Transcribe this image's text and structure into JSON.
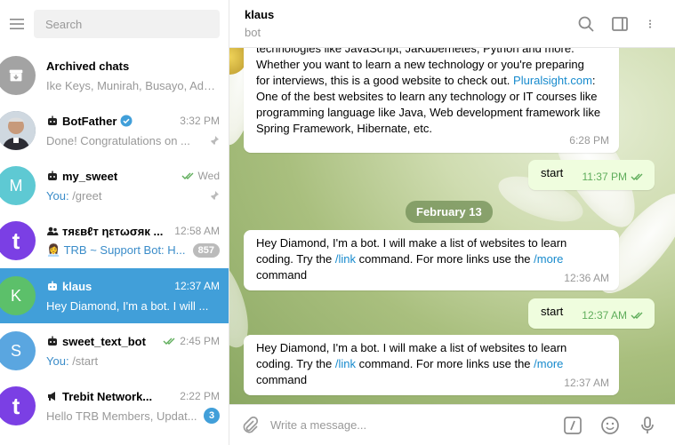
{
  "sidebar": {
    "search_placeholder": "Search",
    "chats": [
      {
        "title": "Archived chats",
        "preview": "Ike Keys, Munirah, Busayo, Ada...",
        "time": "",
        "avatar_letter": "",
        "avatar_color": "#a3a3a3"
      },
      {
        "title": "BotFather",
        "preview": "Done! Congratulations on ...",
        "time": "3:32 PM",
        "avatar_letter": "",
        "avatar_color": "#6d7d8f"
      },
      {
        "title": "my_sweet",
        "preview_you": "You:",
        "preview": "/greet",
        "time": "Wed",
        "avatar_letter": "M",
        "avatar_color": "#5ec9d3"
      },
      {
        "title": "тяεвℓт ηεтωσяк ...",
        "preview": "TRB ~ Support Bot: H...",
        "time": "12:58 AM",
        "badge": "857",
        "avatar_letter": "t",
        "avatar_color": "#7b3fe4"
      },
      {
        "title": "klaus",
        "preview": "Hey Diamond, I'm a bot. I will ...",
        "time": "12:37 AM",
        "avatar_letter": "K",
        "avatar_color": "#5cc06a"
      },
      {
        "title": "sweet_text_bot",
        "preview_you": "You:",
        "preview": "/start",
        "time": "2:45 PM",
        "avatar_letter": "S",
        "avatar_color": "#5aa6e0"
      },
      {
        "title": "Trebit Network...",
        "preview": "Hello TRB Members,  Updat...",
        "time": "2:22 PM",
        "badge": "3",
        "avatar_letter": "t",
        "avatar_color": "#7b3fe4"
      }
    ]
  },
  "header": {
    "name": "klaus",
    "status": "bot"
  },
  "messages": {
    "m1": {
      "line1": "technologies like JavaScript, JaKubernetes, Python and more.",
      "line2": "Whether you want to learn a new technology or you're preparing",
      "line3a": "for interviews, this is a good website to check out. ",
      "line3link": "Pluralsight.com",
      "line3b": ":",
      "line4": "One of the best websites to learn any technology or IT courses like",
      "line5": "programming language like Java, Web development framework like",
      "line6": "Spring Framework, Hibernate, etc.",
      "time": "6:28 PM"
    },
    "m2": {
      "text": "start",
      "time": "11:37 PM"
    },
    "date": "February 13",
    "m3": {
      "line1": "Hey Diamond, I'm a bot. I will make a list of websites to learn",
      "line2a": "coding. Try the ",
      "cmd1": "/link",
      "line2b": " command. For more links use the ",
      "cmd2": "/more",
      "line3": "command",
      "time": "12:36 AM"
    },
    "m4": {
      "text": "start",
      "time": "12:37 AM"
    },
    "m5": {
      "line1": "Hey Diamond, I'm a bot. I will make a list of websites to learn",
      "line2a": "coding. Try the ",
      "cmd1": "/link",
      "line2b": " command. For more links use the ",
      "cmd2": "/more",
      "line3": "command",
      "time": "12:37 AM"
    }
  },
  "composer": {
    "placeholder": "Write a message..."
  },
  "colors": {
    "accent": "#419fd9",
    "link": "#168acd",
    "outgoing": "#effdde",
    "check": "#5fad5b"
  }
}
